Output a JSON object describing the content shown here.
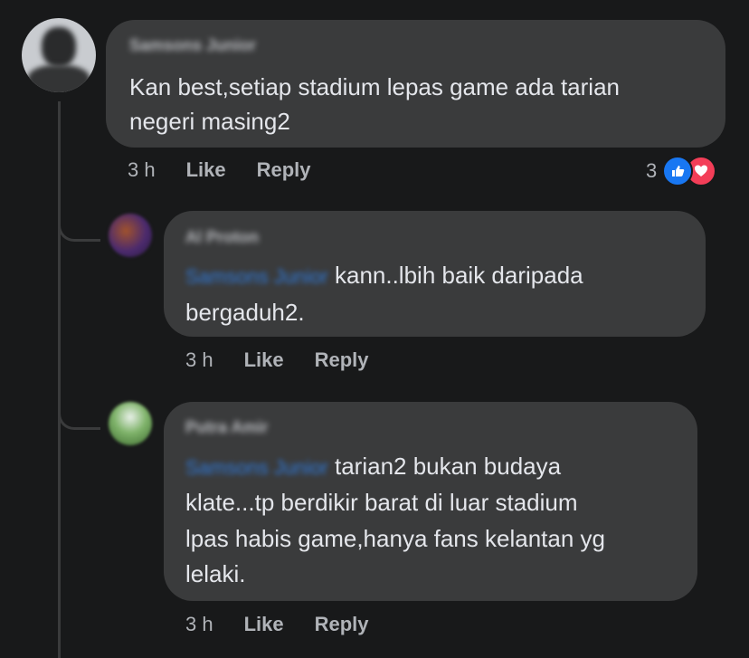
{
  "colors": {
    "background": "#18191a",
    "bubble": "#3a3b3c",
    "mention": "#2d88ff",
    "like": "#1877f2",
    "love": "#f33e58"
  },
  "comments": [
    {
      "author": "Samsons Junior",
      "line1": "Kan best,setiap stadium lepas game ada tarian",
      "line2": "negeri masing2",
      "time": "3 h",
      "like": "Like",
      "reply": "Reply",
      "reaction_count": "3",
      "reaction_icons": [
        "thumbs-up-icon",
        "heart-icon"
      ]
    },
    {
      "author": "Al Proton",
      "mention": "Samsons Junior",
      "line1": "kann..lbih baik daripada",
      "line2": "bergaduh2.",
      "time": "3 h",
      "like": "Like",
      "reply": "Reply"
    },
    {
      "author": "Putra Amir",
      "mention": "Samsons Junior",
      "line1": "tarian2 bukan budaya",
      "line2": "klate...tp berdikir barat di luar stadium",
      "line3": "lpas habis game,hanya fans kelantan yg",
      "line4": "lelaki.",
      "time": "3 h",
      "like": "Like",
      "reply": "Reply"
    }
  ]
}
